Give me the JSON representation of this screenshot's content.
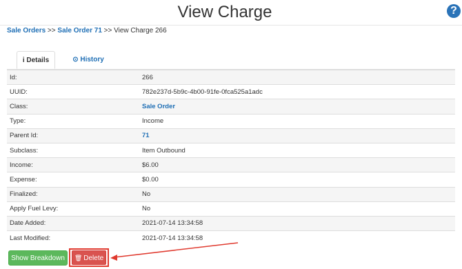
{
  "page": {
    "title": "View Charge",
    "help_icon": "?"
  },
  "breadcrumb": {
    "link1": "Sale Orders",
    "sep1": " >> ",
    "link2": "Sale Order 71",
    "sep2": " >> ",
    "current": "View Charge 266"
  },
  "tabs": [
    {
      "icon": "i",
      "label": "Details",
      "active": true
    },
    {
      "icon": "⊙",
      "label": "History",
      "active": false
    }
  ],
  "details": [
    {
      "label": "Id:",
      "value": "266"
    },
    {
      "label": "UUID:",
      "value": "782e237d-5b9c-4b00-91fe-0fca525a1adc"
    },
    {
      "label": "Class:",
      "value": "Sale Order"
    },
    {
      "label": "Type:",
      "value": "Income"
    },
    {
      "label": "Parent Id:",
      "value": "71"
    },
    {
      "label": "Subclass:",
      "value": "Item Outbound"
    },
    {
      "label": "Income:",
      "value": "$6.00"
    },
    {
      "label": "Expense:",
      "value": "$0.00"
    },
    {
      "label": "Finalized:",
      "value": "No"
    },
    {
      "label": "Apply Fuel Levy:",
      "value": "No"
    },
    {
      "label": "Date Added:",
      "value": "2021-07-14 13:34:58"
    },
    {
      "label": "Last Modified:",
      "value": "2021-07-14 13:34:58"
    }
  ],
  "buttons": {
    "show_breakdown": "Show Breakdown",
    "delete": "Delete"
  },
  "colors": {
    "link": "#1f6fb5",
    "success": "#5cb85c",
    "danger": "#d9534f",
    "annotation": "#e03a2f"
  }
}
